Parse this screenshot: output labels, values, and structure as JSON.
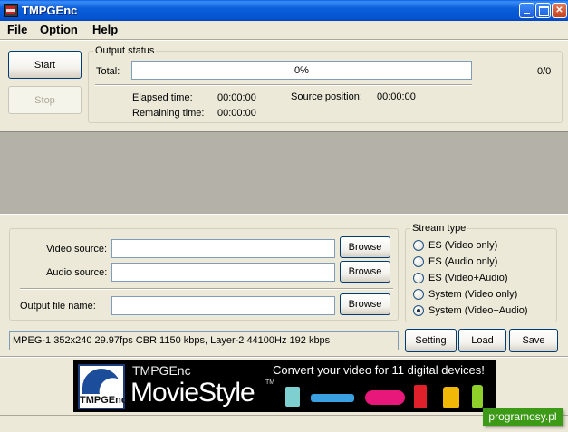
{
  "window": {
    "title": "TMPGEnc"
  },
  "menu": {
    "file": "File",
    "option": "Option",
    "help": "Help"
  },
  "controls": {
    "start": "Start",
    "stop": "Stop"
  },
  "output_status": {
    "label": "Output status",
    "total_label": "Total:",
    "progress_text": "0%",
    "progress_value": 0,
    "count": "0/0",
    "elapsed_label": "Elapsed time:",
    "elapsed_value": "00:00:00",
    "remaining_label": "Remaining time:",
    "remaining_value": "00:00:00",
    "source_position_label": "Source position:",
    "source_position_value": "00:00:00"
  },
  "sources": {
    "video_label": "Video source:",
    "video_value": "",
    "audio_label": "Audio source:",
    "audio_value": "",
    "output_label": "Output file name:",
    "output_value": "",
    "browse": "Browse"
  },
  "stream_type": {
    "label": "Stream type",
    "options": [
      {
        "label": "ES (Video only)",
        "checked": false
      },
      {
        "label": "ES (Audio only)",
        "checked": false
      },
      {
        "label": "ES (Video+Audio)",
        "checked": false
      },
      {
        "label": "System (Video only)",
        "checked": false
      },
      {
        "label": "System (Video+Audio)",
        "checked": true
      }
    ]
  },
  "settings_info": "MPEG-1 352x240 29.97fps CBR 1150 kbps,  Layer-2 44100Hz 192 kbps",
  "actions": {
    "setting": "Setting",
    "load": "Load",
    "save": "Save"
  },
  "banner": {
    "logo_text": "TMPGEnc",
    "brand": "TMPGEnc",
    "product": "MovieStyle",
    "trademark": "TM",
    "tagline": "Convert your video for 11 digital devices!",
    "device_colors": [
      "#7ecfcf",
      "#3aa0e0",
      "#e8187a",
      "#e0202a",
      "#f2b807",
      "#8fcf2a"
    ]
  },
  "watermark": "programosy.pl",
  "colors": {
    "titlebar": "#0553d0",
    "progress": "#2f63d8",
    "watermark": "#3d9a17"
  }
}
